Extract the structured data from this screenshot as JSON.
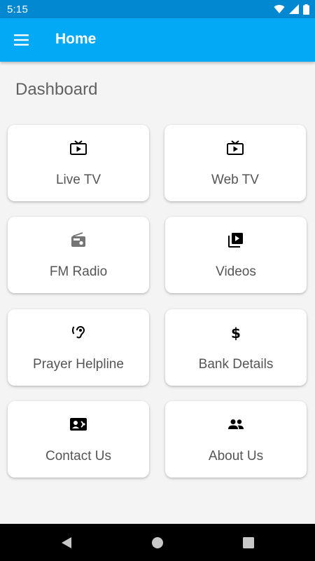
{
  "status_bar": {
    "time": "5:15"
  },
  "app_bar": {
    "title": "Home"
  },
  "dashboard": {
    "title": "Dashboard",
    "cards": [
      {
        "label": "Live TV",
        "icon": "live-tv-icon"
      },
      {
        "label": "Web TV",
        "icon": "live-tv-icon"
      },
      {
        "label": "FM Radio",
        "icon": "radio-icon"
      },
      {
        "label": "Videos",
        "icon": "video-library-icon"
      },
      {
        "label": "Prayer Helpline",
        "icon": "hearing-icon"
      },
      {
        "label": "Bank Details",
        "icon": "dollar-icon"
      },
      {
        "label": "Contact Us",
        "icon": "contact-card-icon"
      },
      {
        "label": "About Us",
        "icon": "people-icon"
      }
    ]
  },
  "colors": {
    "status_bar": "#0288d1",
    "app_bar": "#03a9f4",
    "background": "#f4f4f4",
    "card": "#ffffff",
    "nav_bar": "#000000"
  }
}
